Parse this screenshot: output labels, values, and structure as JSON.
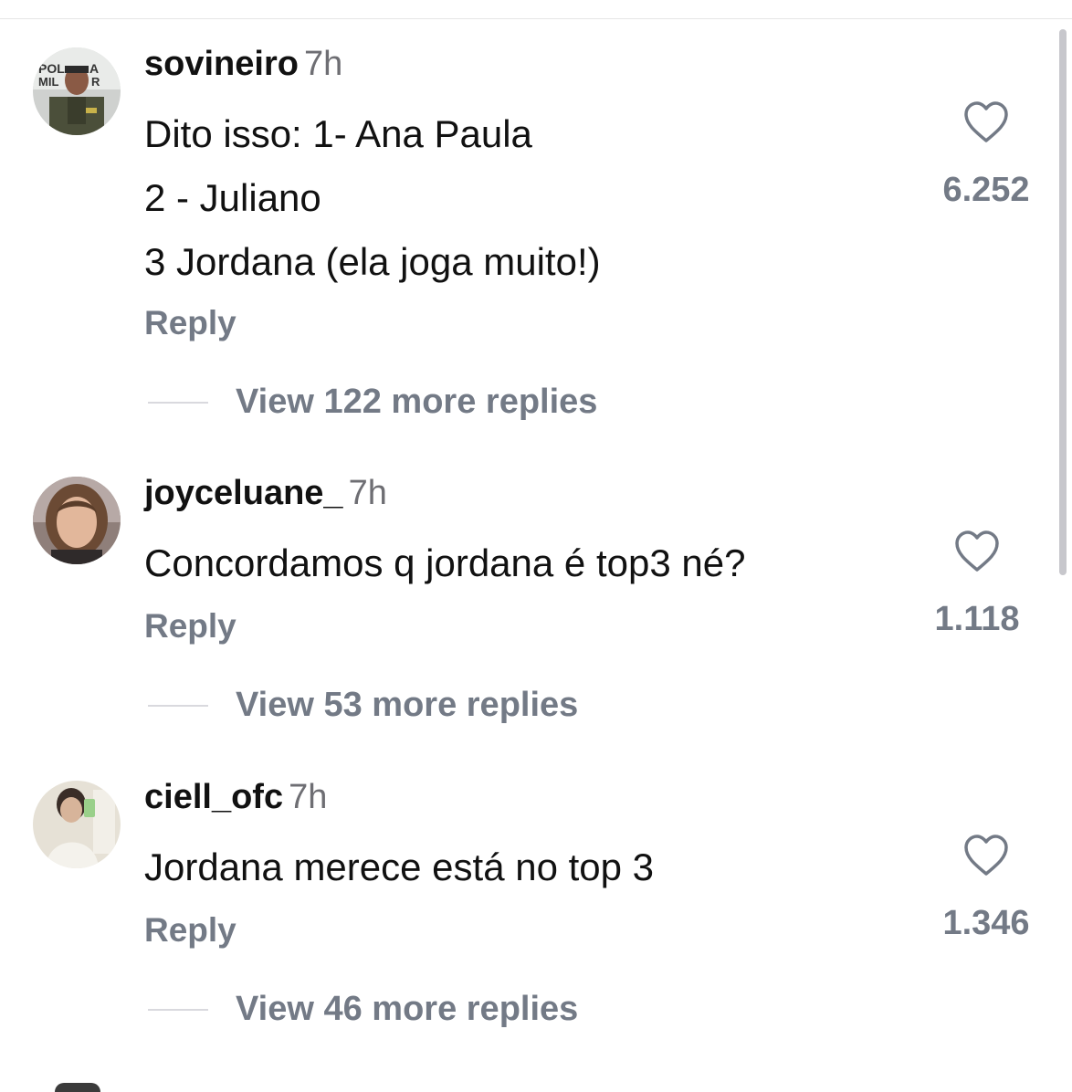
{
  "colors": {
    "text": "#111111",
    "secondary": "#737a86",
    "time": "#6e6e73",
    "divider": "#d9d9de"
  },
  "comments": [
    {
      "username": "sovineiro",
      "time": "7h",
      "lines": [
        "Dito isso: 1- Ana Paula",
        "2 - Juliano",
        "3 Jordana (ela joga muito!)"
      ],
      "reply_label": "Reply",
      "likes": "6.252",
      "view_replies": "View 122 more replies",
      "avatar_icon": "police-officer-avatar",
      "avatar_badge_text": "POLICIA MILITAR"
    },
    {
      "username": "joyceluane_",
      "time": "7h",
      "lines": [
        "Concordamos q jordana é top3 né?"
      ],
      "reply_label": "Reply",
      "likes": "1.118",
      "view_replies": "View 53 more replies",
      "avatar_icon": "woman-portrait-avatar"
    },
    {
      "username": "ciell_ofc",
      "time": "7h",
      "lines": [
        "Jordana merece está no top 3"
      ],
      "reply_label": "Reply",
      "likes": "1.346",
      "view_replies": "View 46 more replies",
      "avatar_icon": "mirror-selfie-avatar"
    }
  ]
}
